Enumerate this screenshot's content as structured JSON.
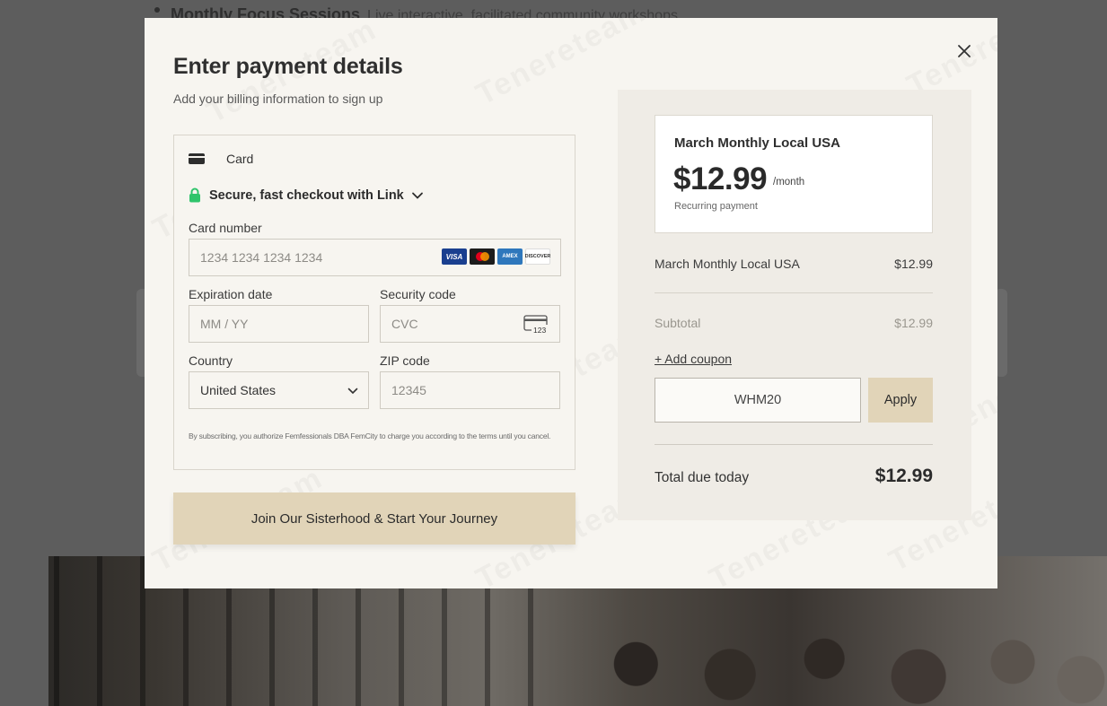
{
  "background": {
    "heading": "Monthly Focus Sessions",
    "heading_sub": "Live interactive, facilitated community workshops"
  },
  "modal": {
    "title": "Enter payment details",
    "subtitle": "Add your billing information to sign up",
    "close_icon": "close-icon"
  },
  "payment": {
    "method_tab": "Card",
    "link_checkout": "Secure, fast checkout with Link",
    "card_number": {
      "label": "Card number",
      "placeholder": "1234 1234 1234 1234"
    },
    "brands": [
      "VISA",
      "",
      "AMEX",
      "DISCOVER"
    ],
    "expiry": {
      "label": "Expiration date",
      "placeholder": "MM / YY"
    },
    "security": {
      "label": "Security code",
      "placeholder": "CVC",
      "icon_text": "123"
    },
    "country": {
      "label": "Country",
      "value": "United States"
    },
    "zip": {
      "label": "ZIP code",
      "placeholder": "12345"
    },
    "terms": "By subscribing, you authorize Femfessionals DBA FemCity to charge you according to the terms until you cancel."
  },
  "cta": {
    "label": "Join Our Sisterhood & Start Your Journey"
  },
  "summary": {
    "plan_name": "March Monthly Local USA",
    "price": "$12.99",
    "period": "/month",
    "recurring": "Recurring payment",
    "line_item": {
      "name": "March Monthly Local USA",
      "amount": "$12.99"
    },
    "subtotal": {
      "label": "Subtotal",
      "amount": "$12.99"
    },
    "add_coupon": "+ Add coupon",
    "coupon_value": "WHM20",
    "apply": "Apply",
    "total": {
      "label": "Total due today",
      "amount": "$12.99"
    }
  },
  "watermark": "Tenereteam",
  "colors": {
    "accent": "#e1d4b8",
    "modal_bg": "#f7f5f0",
    "lock_green": "#2fc46b"
  }
}
